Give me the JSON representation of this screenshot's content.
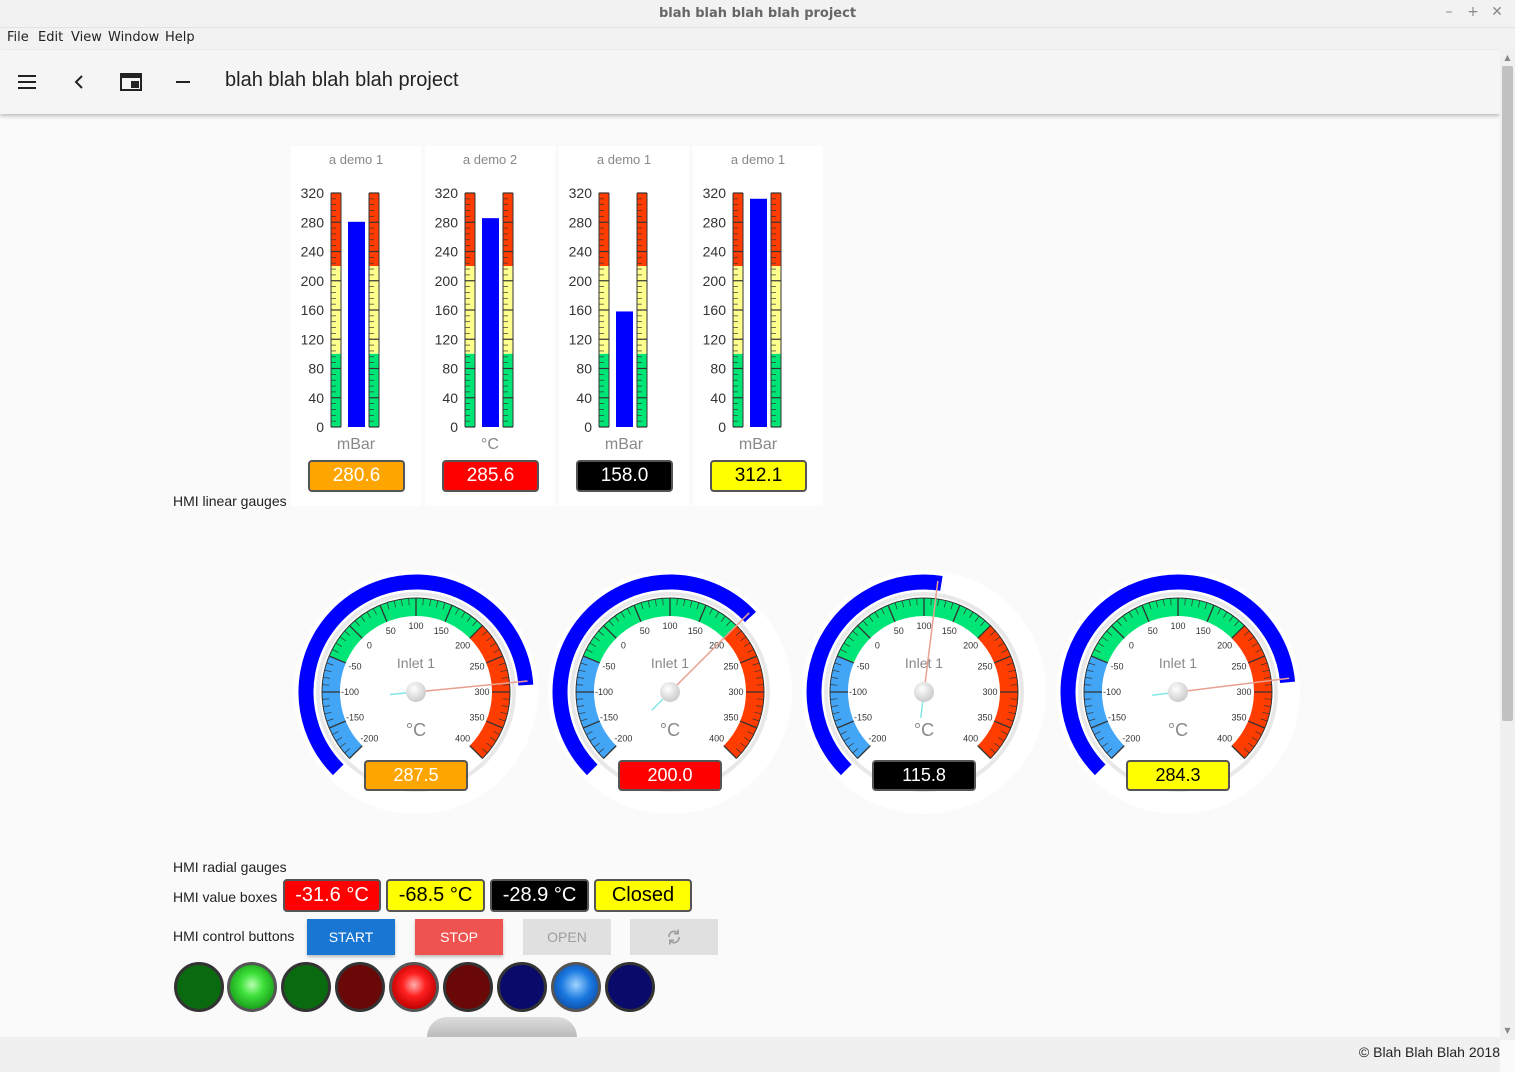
{
  "window": {
    "title": "blah blah blah blah project"
  },
  "menu": [
    "File",
    "Edit",
    "View",
    "Window",
    "Help"
  ],
  "toolbar": {
    "title": "blah blah blah blah project",
    "icons": [
      "menu-icon",
      "chevron-left-icon",
      "window-icon",
      "minus-icon"
    ]
  },
  "sections": {
    "linear": "HMI linear gauges",
    "radial": "HMI radial gauges",
    "valueboxes": "HMI value boxes",
    "buttons": "HMI control buttons"
  },
  "linear_gauges": [
    {
      "caption": "a demo 1",
      "unit": "mBar",
      "value": 280.6,
      "display": "280.6",
      "box_bg": "#ffa500",
      "box_fg": "#ffffff"
    },
    {
      "caption": "a demo 2",
      "unit": "°C",
      "value": 285.6,
      "display": "285.6",
      "box_bg": "#ff0000",
      "box_fg": "#ffffff"
    },
    {
      "caption": "a demo 1",
      "unit": "mBar",
      "value": 158.0,
      "display": "158.0",
      "box_bg": "#000000",
      "box_fg": "#ffffff"
    },
    {
      "caption": "a demo 1",
      "unit": "mBar",
      "value": 312.1,
      "display": "312.1",
      "box_bg": "#ffff00",
      "box_fg": "#000000"
    }
  ],
  "linear_scale": {
    "min": 0,
    "max": 320,
    "ticks": [
      "0",
      "40",
      "80",
      "120",
      "160",
      "200",
      "240",
      "280",
      "320"
    ]
  },
  "radial_gauges": [
    {
      "label": "Inlet 1",
      "unit": "°C",
      "value": 287.5,
      "display": "287.5",
      "box_bg": "#ffa500",
      "box_fg": "#ffffff"
    },
    {
      "label": "Inlet 1",
      "unit": "°C",
      "value": 200.0,
      "display": "200.0",
      "box_bg": "#ff0000",
      "box_fg": "#ffffff"
    },
    {
      "label": "Inlet 1",
      "unit": "°C",
      "value": 115.8,
      "display": "115.8",
      "box_bg": "#000000",
      "box_fg": "#ffffff"
    },
    {
      "label": "Inlet 1",
      "unit": "°C",
      "value": 284.3,
      "display": "284.3",
      "box_bg": "#ffff00",
      "box_fg": "#000000"
    }
  ],
  "radial_scale": {
    "min": -200,
    "max": 400,
    "ticks": [
      "-200",
      "-150",
      "-100",
      "-50",
      "0",
      "50",
      "100",
      "150",
      "200",
      "250",
      "300",
      "350",
      "400"
    ]
  },
  "value_boxes": [
    {
      "text": "-31.6 °C",
      "bg": "#ff0000",
      "fg": "#ffffff"
    },
    {
      "text": "-68.5 °C",
      "bg": "#ffff00",
      "fg": "#000000"
    },
    {
      "text": "-28.9 °C",
      "bg": "#000000",
      "fg": "#ffffff"
    },
    {
      "text": "Closed",
      "bg": "#ffff00",
      "fg": "#000000"
    }
  ],
  "buttons": [
    {
      "label": "START",
      "bg": "#1976d2",
      "fg": "#ffffff",
      "enabled": true
    },
    {
      "label": "STOP",
      "bg": "#ef5350",
      "fg": "#ffffff",
      "enabled": true
    },
    {
      "label": "OPEN",
      "bg": "#e0e0e0",
      "fg": "#9e9e9e",
      "enabled": false
    },
    {
      "label": "",
      "icon": "refresh-icon",
      "bg": "#e0e0e0",
      "fg": "#9e9e9e",
      "enabled": false
    }
  ],
  "leds": [
    {
      "color": "green",
      "on": false
    },
    {
      "color": "green",
      "on": true
    },
    {
      "color": "green",
      "on": false
    },
    {
      "color": "red",
      "on": false
    },
    {
      "color": "red",
      "on": true
    },
    {
      "color": "red",
      "on": false
    },
    {
      "color": "blue",
      "on": false
    },
    {
      "color": "blue",
      "on": true
    },
    {
      "color": "blue",
      "on": false
    }
  ],
  "footer": {
    "copyright": "© Blah Blah Blah 2018"
  },
  "colors": {
    "bar": "#0000ff",
    "zone_green": "#00e676",
    "zone_yellow": "#ffff8d",
    "zone_red": "#ff3d00",
    "zone_blue": "#42a5f5"
  }
}
